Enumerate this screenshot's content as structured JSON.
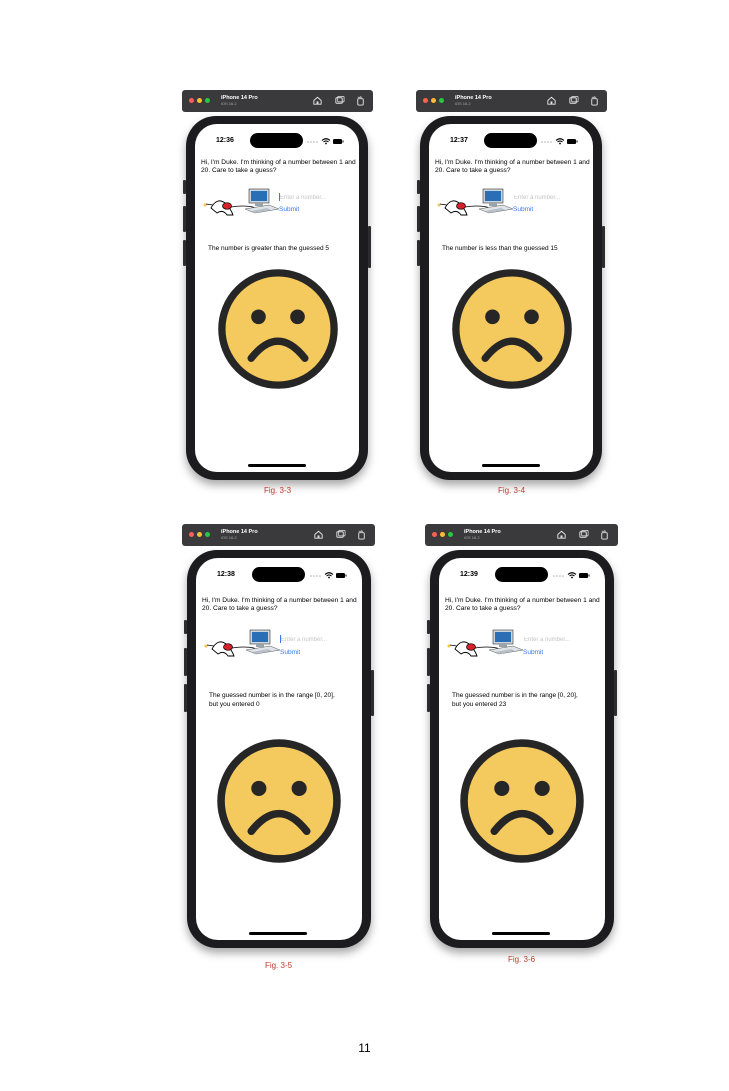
{
  "figures": [
    {
      "toolbar": {
        "device": "iPhone 14 Pro",
        "os": "iOS 16.2"
      },
      "status": {
        "time": "12:36"
      },
      "app": {
        "intro": "Hi, I'm Duke. I'm thinking of a number between 1 and 20. Care to take a guess?",
        "input_placeholder": "Enter a number...",
        "submit_label": "Submit",
        "message": "The number is greater than the guessed 5"
      },
      "caption": "Fig. 3-3"
    },
    {
      "toolbar": {
        "device": "iPhone 14 Pro",
        "os": "iOS 16.2"
      },
      "status": {
        "time": "12:37"
      },
      "app": {
        "intro": "Hi, I'm Duke. I'm thinking of a number between 1 and 20. Care to take a guess?",
        "input_placeholder": "Enter a number...",
        "submit_label": "Submit",
        "message": "The number is less than the guessed 15"
      },
      "caption": "Fig. 3-4"
    },
    {
      "toolbar": {
        "device": "iPhone 14 Pro",
        "os": "iOS 16.2"
      },
      "status": {
        "time": "12:38"
      },
      "app": {
        "intro": "Hi, I'm Duke. I'm thinking of a number between 1 and 20. Care to take a guess?",
        "input_placeholder": "Enter a number...",
        "submit_label": "Submit",
        "message": "The guessed number is in the range [0, 20], but you entered 0"
      },
      "caption": "Fig. 3-5"
    },
    {
      "toolbar": {
        "device": "iPhone 14 Pro",
        "os": "iOS 16.2"
      },
      "status": {
        "time": "12:39"
      },
      "app": {
        "intro": "Hi, I'm Duke. I'm thinking of a number between 1 and 20. Care to take a guess?",
        "input_placeholder": "Enter a number...",
        "submit_label": "Submit",
        "message": "The guessed number is in the range [0, 20], but you entered 23"
      },
      "caption": "Fig. 3-6"
    }
  ],
  "page_number": "11",
  "colors": {
    "toolbar_bg": "#3a3a3c",
    "traffic_red": "#ff5f57",
    "traffic_yellow": "#febc2e",
    "traffic_green": "#28c840",
    "link_blue": "#3478f6",
    "caption_red": "#c0392b",
    "face_fill": "#f4c95d",
    "face_outline": "#262626"
  },
  "icons": [
    "home-icon",
    "screenshot-icon",
    "rotate-icon",
    "wifi-icon",
    "battery-icon",
    "sad-face-icon",
    "duke-mascot-icon",
    "computer-icon"
  ]
}
